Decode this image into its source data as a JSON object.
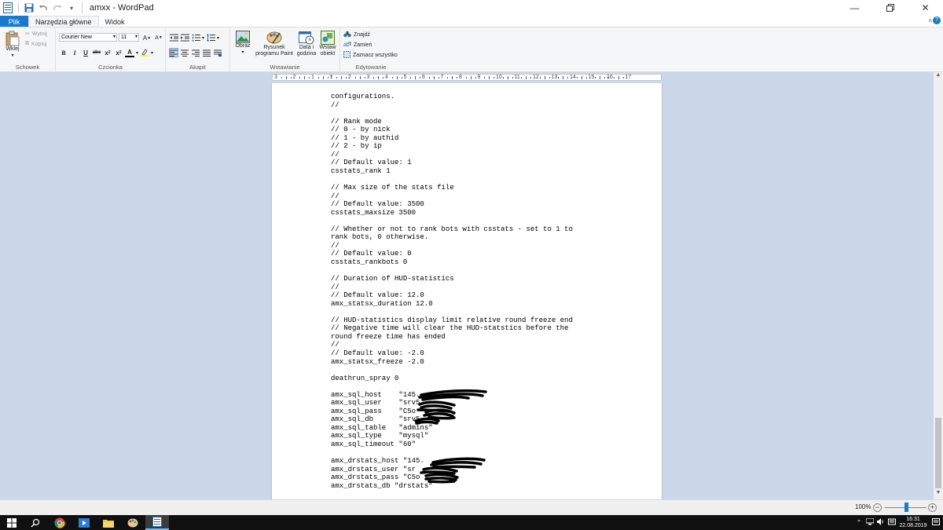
{
  "window": {
    "title": "amxx - WordPad"
  },
  "tabs": {
    "file": "Plik",
    "home": "Narzędzia główne",
    "view": "Widok"
  },
  "ribbon": {
    "clipboard": {
      "paste": "Wklej",
      "cut": "Wytnij",
      "copy": "Kopiuj",
      "label": "Schowek"
    },
    "font": {
      "family": "Courier New",
      "size": "11",
      "label": "Czcionka"
    },
    "paragraph": {
      "label": "Akapit"
    },
    "insert": {
      "picture": "Obraz",
      "paint_line1": "Rysunek",
      "paint_line2": "programu Paint",
      "datetime_line1": "Data i",
      "datetime_line2": "godzina",
      "object_line1": "Wstaw",
      "object_line2": "obiekt",
      "label": "Wstawianie"
    },
    "editing": {
      "find": "Znajdź",
      "replace": "Zamień",
      "select_all": "Zaznacz wszystko",
      "label": "Edytowanie"
    }
  },
  "ruler": {
    "numbers": [
      "3",
      "2",
      "1",
      "1",
      "2",
      "3",
      "4",
      "5",
      "6",
      "7",
      "8",
      "9",
      "10",
      "11",
      "12",
      "13",
      "14",
      "15",
      "16",
      "17"
    ]
  },
  "document": {
    "lines": [
      "configurations.",
      "//",
      "",
      "// Rank mode",
      "// 0 - by nick",
      "// 1 - by authid",
      "// 2 - by ip",
      "//",
      "// Default value: 1",
      "csstats_rank 1",
      "",
      "// Max size of the stats file",
      "//",
      "// Default value: 3500",
      "csstats_maxsize 3500",
      "",
      "// Whether or not to rank bots with csstats - set to 1 to",
      "rank bots, 0 otherwise.",
      "//",
      "// Default value: 0",
      "csstats_rankbots 0",
      "",
      "// Duration of HUD-statistics",
      "//",
      "// Default value: 12.0",
      "amx_statsx_duration 12.0",
      "",
      "// HUD-statistics display limit relative round freeze end",
      "// Negative time will clear the HUD-statstics before the",
      "round freeze time has ended",
      "//",
      "// Default value: -2.0",
      "amx_statsx_freeze -2.0",
      "",
      "deathrun_spray 0",
      "",
      "amx_sql_host    \"145.",
      "amx_sql_user    \"srv5",
      "amx_sql_pass    \"C5o",
      "amx_sql_db      \"srv5",
      "amx_sql_table   \"admins\"",
      "amx_sql_type    \"mysql\"",
      "amx_sql_timeout \"60\"",
      "",
      "amx_drstats_host \"145.",
      "amx_drstats_user \"sr",
      "amx_drstats_pass \"C5o",
      "amx_drstats_db \"drstats\""
    ]
  },
  "status": {
    "zoom": "100%"
  },
  "taskbar": {
    "time": "16:31",
    "date": "22.08.2019"
  }
}
